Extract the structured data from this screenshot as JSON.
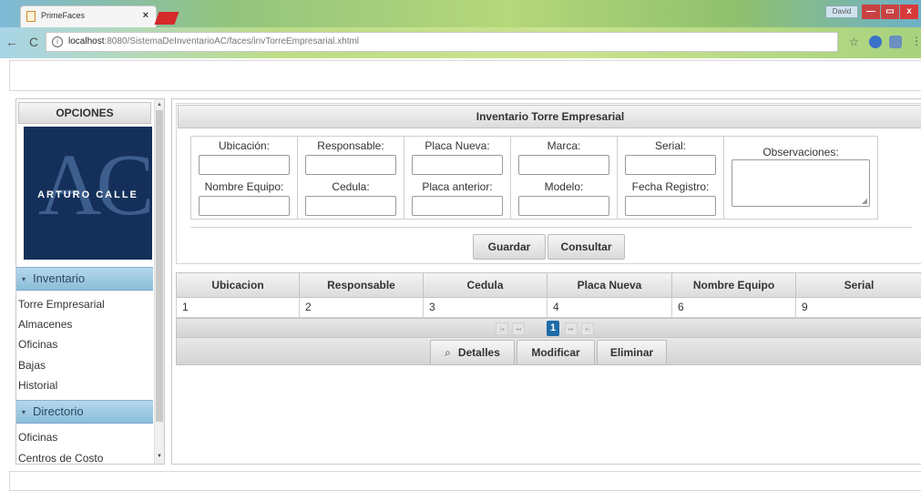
{
  "browser": {
    "tab_title": "PrimeFaces",
    "tab_close": "×",
    "user_badge": "David",
    "window_controls": {
      "minimize": "—",
      "maximize": "▭",
      "close": "x"
    },
    "url_host": "localhost",
    "url_rest": ":8080/SistemaDeInventarioAC/faces/invTorreEmpresarial.xhtml",
    "nav_back": "←",
    "nav_reload": "C",
    "info_glyph": "i",
    "star_glyph": "☆",
    "menu_glyph": "⋮"
  },
  "sidebar": {
    "header": "OPCIONES",
    "logo": {
      "monogram": "AC",
      "text": "ARTURO CALLE",
      "bg_color": "#14305a"
    },
    "sections": [
      {
        "title": "Inventario",
        "items": [
          "Torre Empresarial",
          "Almacenes",
          "Oficinas",
          "Bajas",
          "Historial"
        ]
      },
      {
        "title": "Directorio",
        "items": [
          "Oficinas",
          "Centros de Costo"
        ]
      }
    ],
    "accordion_glyph": "▾",
    "scroll_up": "▲",
    "scroll_down": "▼"
  },
  "form": {
    "title": "Inventario Torre Empresarial",
    "row1_labels": [
      "Ubicación:",
      "Responsable:",
      "Placa Nueva:",
      "Marca:",
      "Serial:"
    ],
    "row2_labels": [
      "Nombre Equipo:",
      "Cedula:",
      "Placa anterior:",
      "Modelo:",
      "Fecha Registro:"
    ],
    "observaciones_label": "Observaciones:",
    "buttons": {
      "guardar": "Guardar",
      "consultar": "Consultar"
    }
  },
  "table": {
    "columns": [
      "Ubicacion",
      "Responsable",
      "Cedula",
      "Placa Nueva",
      "Nombre Equipo",
      "Serial"
    ],
    "rows": [
      [
        "1",
        "2",
        "3",
        "4",
        "6",
        "9"
      ]
    ],
    "paginator": {
      "current_page": "1",
      "first": "|◂",
      "prev": "◂◂",
      "next": "▸▸",
      "last": "▸|"
    },
    "actions": {
      "detalles": "Detalles",
      "modificar": "Modificar",
      "eliminar": "Eliminar",
      "search_glyph": "⌕"
    }
  },
  "colors": {
    "accordion_header": "#a3cbe4",
    "paginator_active": "#1e6ca8",
    "logo_bg": "#14305a"
  }
}
